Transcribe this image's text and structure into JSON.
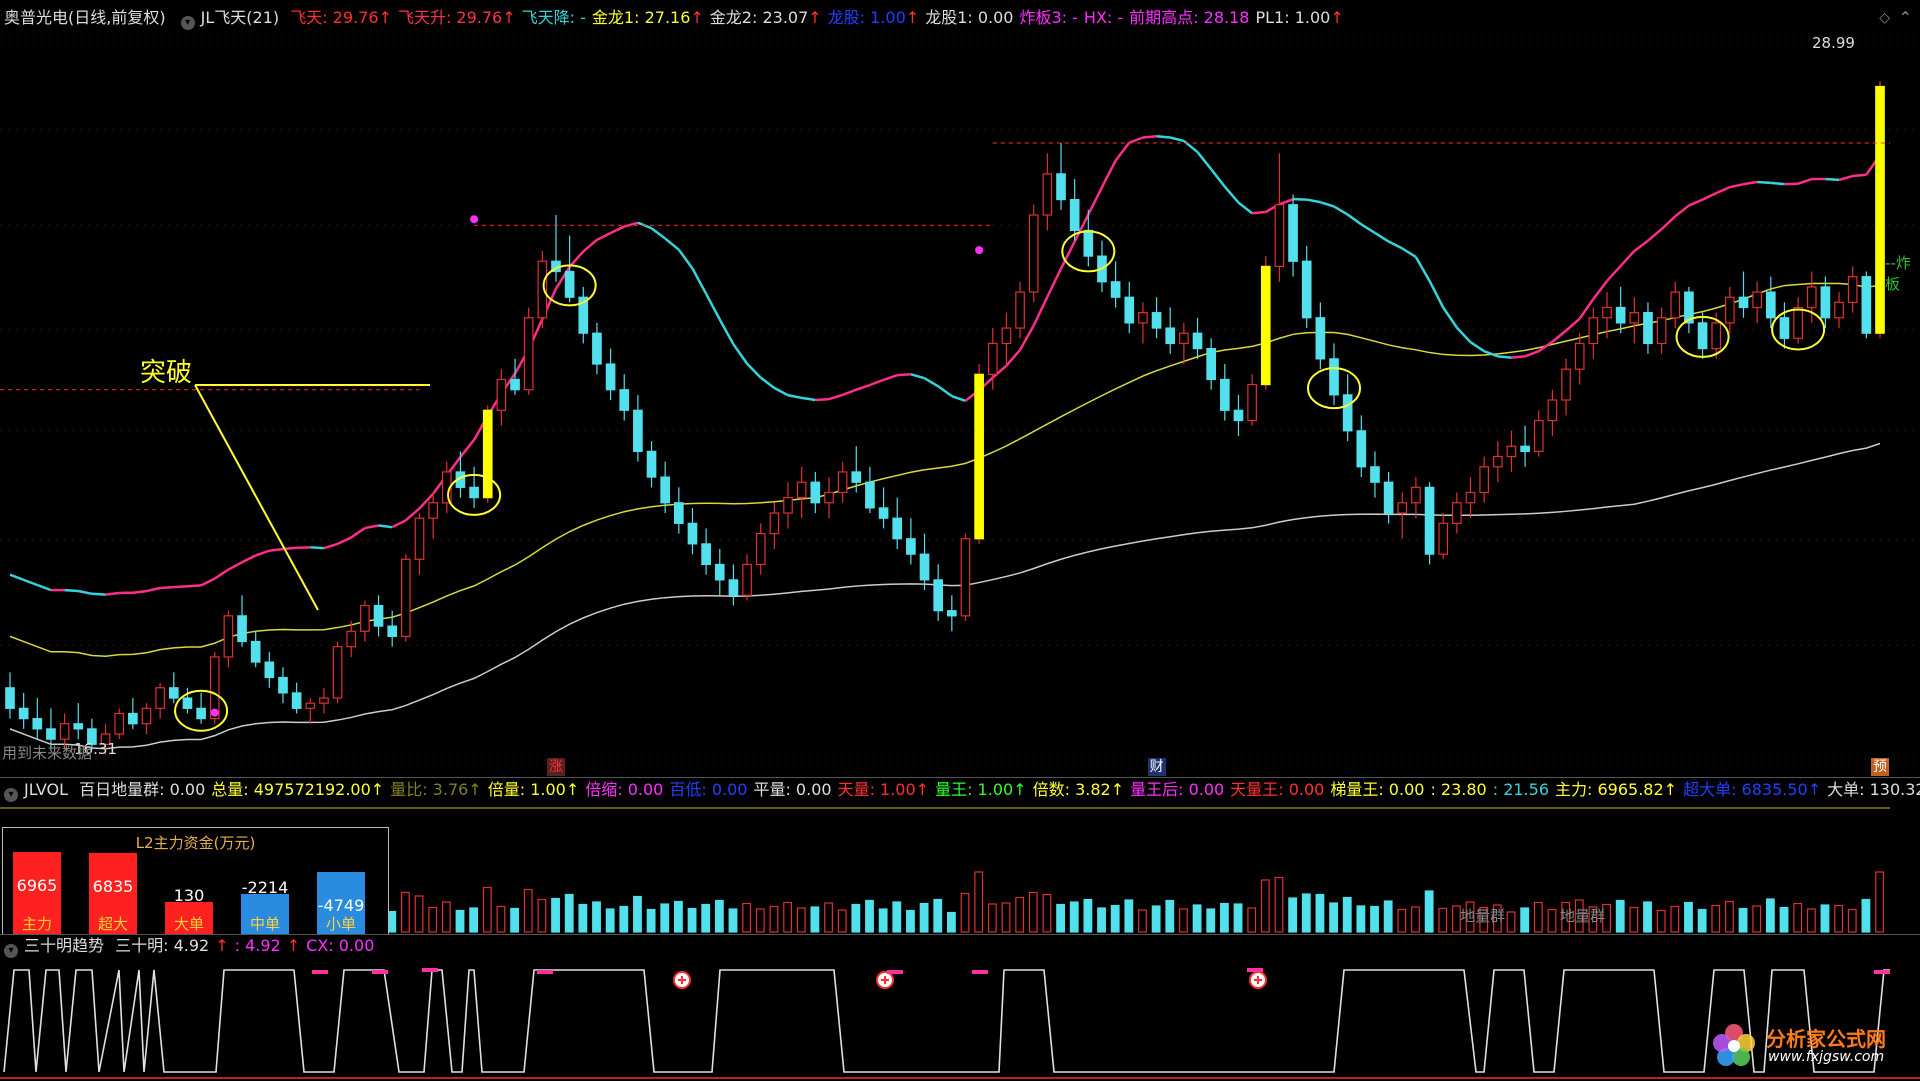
{
  "colors": {
    "up": "#e03030",
    "down": "#52e0ec",
    "yellow": "#ffff00",
    "pink": "#ff2e8a",
    "cyan": "#37d3db",
    "grey": "#bbbbbb"
  },
  "top_bar": {
    "stock": "奥普光电(日线,前复权)",
    "indicator": "JL飞天(21)",
    "items": [
      {
        "text": "飞天: 29.76",
        "color": "#ff3030",
        "arrow": "↑"
      },
      {
        "text": "飞天升: 29.76",
        "color": "#ff3050",
        "arrow": "↑"
      },
      {
        "text": "飞天降: -",
        "color": "#37d3db",
        "arrow": ""
      },
      {
        "text": "金龙1: 27.16",
        "color": "#ffff30",
        "arrow": "↑"
      },
      {
        "text": "金龙2: 23.07",
        "color": "#dddddd",
        "arrow": "↑"
      },
      {
        "text": "龙股: 1.00",
        "color": "#2040ff",
        "arrow": "↑"
      },
      {
        "text": "龙股1: 0.00",
        "color": "#dddddd",
        "arrow": ""
      },
      {
        "text": "炸板3: -",
        "color": "#ff30ff",
        "arrow": ""
      },
      {
        "text": "HX: -",
        "color": "#ff30ff",
        "arrow": ""
      },
      {
        "text": "前期高点: 28.18",
        "color": "#ff30ff",
        "arrow": ""
      },
      {
        "text": "PL1: 1.00",
        "color": "#dddddd",
        "arrow": "↑"
      }
    ]
  },
  "main_chart": {
    "price_label_right": "28.99",
    "low_label": "16.31",
    "bottom_left_text": "用到未来数据",
    "annotation": "突破",
    "markers": [
      {
        "text": "涨",
        "color": "#ff3030",
        "bg": "#552222"
      },
      {
        "text": "财",
        "color": "#ffffff",
        "bg": "#203070"
      },
      {
        "text": "预",
        "color": "#ffffff",
        "bg": "#c06020"
      }
    ],
    "right_edge_label": "--炸板"
  },
  "vol_bar": {
    "name": "JLVOL",
    "items": [
      {
        "text": "百日地量群: 0.00",
        "color": "#dddddd"
      },
      {
        "text": "总量: 497572192.00↑",
        "color": "#ffff30"
      },
      {
        "text": "量比: 3.76↑",
        "color": "#808020"
      },
      {
        "text": "倍量: 1.00↑",
        "color": "#ffff30"
      },
      {
        "text": "倍缩: 0.00",
        "color": "#ff30ff"
      },
      {
        "text": "百低: 0.00",
        "color": "#2040ff"
      },
      {
        "text": "平量: 0.00",
        "color": "#dddddd"
      },
      {
        "text": "天量: 1.00↑",
        "color": "#ff3030"
      },
      {
        "text": "量王: 1.00↑",
        "color": "#30ff30"
      },
      {
        "text": "倍数: 3.82↑",
        "color": "#ffff30"
      },
      {
        "text": "量王后: 0.00",
        "color": "#ff30ff"
      },
      {
        "text": "天量王: 0.00",
        "color": "#ff3030"
      },
      {
        "text": "梯量王: 0.00",
        "color": "#ffff30"
      },
      {
        "text": ": 23.80",
        "color": "#ffff30"
      },
      {
        "text": ": 21.56",
        "color": "#37d3db"
      },
      {
        "text": "主力: 6965.82↑",
        "color": "#ffff30"
      },
      {
        "text": "超大单: 6835.50↑",
        "color": "#2040ff"
      },
      {
        "text": "大单: 130.32↓",
        "color": "#dddddd"
      },
      {
        "text": "中单",
        "color": "#ffff30"
      }
    ],
    "l2_panel": {
      "title": "L2主力资金(万元)",
      "cols": [
        {
          "value": "6965",
          "label": "主力",
          "color": "#ff2020",
          "level": 1.0
        },
        {
          "value": "6835",
          "label": "超大",
          "color": "#ff2020",
          "level": 0.98
        },
        {
          "value": "130",
          "label": "大单",
          "color": "#ff2020",
          "level": 0.2
        },
        {
          "value": "-2214",
          "label": "中单",
          "color": "#2a8ce0",
          "level": 0.32
        },
        {
          "value": "-4749",
          "label": "小单",
          "color": "#2a8ce0",
          "level": 0.68
        }
      ]
    },
    "ground_labels": [
      "地量群",
      "地量群"
    ]
  },
  "trend_bar": {
    "name": "三十明趋势",
    "items": [
      {
        "text": "三十明: 4.92",
        "color": "#dddddd"
      },
      {
        "text": "↑",
        "color": "#ff3030"
      },
      {
        "text": ": 4.92",
        "color": "#ff30ff"
      },
      {
        "text": "↑",
        "color": "#ff3030"
      },
      {
        "text": "CX: 0.00",
        "color": "#ff30ff"
      }
    ]
  },
  "watermark": {
    "name": "分析家公式网",
    "url": "www.fxjgsw.com"
  },
  "chart_data": {
    "type": "candlestick",
    "title": "奥普光电(日线,前复权)",
    "price_label": 28.99,
    "low_label": 16.31,
    "ohlc": [
      [
        17.2,
        17.5,
        16.6,
        16.8
      ],
      [
        16.8,
        17.1,
        16.4,
        16.6
      ],
      [
        16.6,
        17.0,
        16.2,
        16.4
      ],
      [
        16.4,
        16.8,
        16.0,
        16.2
      ],
      [
        16.2,
        16.7,
        16.0,
        16.5
      ],
      [
        16.5,
        16.9,
        16.2,
        16.4
      ],
      [
        16.4,
        16.6,
        16.0,
        16.1
      ],
      [
        16.1,
        16.5,
        15.9,
        16.3
      ],
      [
        16.3,
        16.8,
        16.2,
        16.7
      ],
      [
        16.7,
        17.0,
        16.4,
        16.5
      ],
      [
        16.5,
        16.9,
        16.3,
        16.8
      ],
      [
        16.8,
        17.3,
        16.6,
        17.2
      ],
      [
        17.2,
        17.5,
        16.9,
        17.0
      ],
      [
        17.0,
        17.2,
        16.7,
        16.8
      ],
      [
        16.8,
        17.1,
        16.5,
        16.6
      ],
      [
        16.6,
        17.9,
        16.5,
        17.8
      ],
      [
        17.8,
        18.7,
        17.6,
        18.6
      ],
      [
        18.6,
        19.0,
        18.0,
        18.1
      ],
      [
        18.1,
        18.3,
        17.6,
        17.7
      ],
      [
        17.7,
        17.9,
        17.2,
        17.4
      ],
      [
        17.4,
        17.6,
        16.9,
        17.1
      ],
      [
        17.1,
        17.3,
        16.7,
        16.8
      ],
      [
        16.8,
        17.0,
        16.5,
        16.9
      ],
      [
        16.9,
        17.2,
        16.7,
        17.0
      ],
      [
        17.0,
        18.1,
        16.9,
        18.0
      ],
      [
        18.0,
        18.5,
        17.8,
        18.3
      ],
      [
        18.3,
        18.9,
        18.1,
        18.8
      ],
      [
        18.8,
        19.0,
        18.2,
        18.4
      ],
      [
        18.4,
        18.7,
        18.0,
        18.2
      ],
      [
        18.2,
        19.8,
        18.1,
        19.7
      ],
      [
        19.7,
        20.6,
        19.4,
        20.5
      ],
      [
        20.5,
        21.0,
        20.1,
        20.8
      ],
      [
        20.8,
        21.6,
        20.6,
        21.4
      ],
      [
        21.4,
        21.8,
        20.9,
        21.1
      ],
      [
        21.1,
        21.5,
        20.7,
        20.9
      ],
      [
        20.9,
        22.7,
        20.8,
        22.6
      ],
      [
        22.6,
        23.4,
        22.3,
        23.2
      ],
      [
        23.2,
        23.6,
        22.9,
        23.0
      ],
      [
        23.0,
        24.6,
        22.9,
        24.4
      ],
      [
        24.4,
        25.7,
        24.2,
        25.5
      ],
      [
        25.5,
        26.4,
        25.1,
        25.3
      ],
      [
        25.3,
        26.0,
        24.7,
        24.8
      ],
      [
        24.8,
        25.0,
        23.9,
        24.1
      ],
      [
        24.1,
        24.3,
        23.3,
        23.5
      ],
      [
        23.5,
        23.8,
        22.8,
        23.0
      ],
      [
        23.0,
        23.3,
        22.4,
        22.6
      ],
      [
        22.6,
        22.9,
        21.6,
        21.8
      ],
      [
        21.8,
        22.0,
        21.1,
        21.3
      ],
      [
        21.3,
        21.6,
        20.6,
        20.8
      ],
      [
        20.8,
        21.1,
        20.2,
        20.4
      ],
      [
        20.4,
        20.7,
        19.8,
        20.0
      ],
      [
        20.0,
        20.3,
        19.4,
        19.6
      ],
      [
        19.6,
        19.9,
        19.0,
        19.3
      ],
      [
        19.3,
        19.6,
        18.8,
        19.0
      ],
      [
        19.0,
        19.8,
        18.9,
        19.6
      ],
      [
        19.6,
        20.4,
        19.4,
        20.2
      ],
      [
        20.2,
        20.8,
        19.9,
        20.6
      ],
      [
        20.6,
        21.2,
        20.3,
        20.9
      ],
      [
        20.9,
        21.5,
        20.5,
        21.2
      ],
      [
        21.2,
        21.4,
        20.6,
        20.8
      ],
      [
        20.8,
        21.3,
        20.5,
        21.0
      ],
      [
        21.0,
        21.6,
        20.8,
        21.4
      ],
      [
        21.4,
        21.9,
        21.0,
        21.2
      ],
      [
        21.2,
        21.5,
        20.6,
        20.7
      ],
      [
        20.7,
        21.1,
        20.3,
        20.5
      ],
      [
        20.5,
        20.9,
        19.9,
        20.1
      ],
      [
        20.1,
        20.5,
        19.6,
        19.8
      ],
      [
        19.8,
        20.2,
        19.1,
        19.3
      ],
      [
        19.3,
        19.6,
        18.5,
        18.7
      ],
      [
        18.7,
        19.0,
        18.3,
        18.6
      ],
      [
        18.6,
        20.2,
        18.5,
        20.1
      ],
      [
        20.1,
        23.5,
        20.0,
        23.3
      ],
      [
        23.3,
        24.2,
        23.0,
        23.9
      ],
      [
        23.9,
        24.5,
        23.5,
        24.2
      ],
      [
        24.2,
        25.1,
        24.0,
        24.9
      ],
      [
        24.9,
        26.6,
        24.7,
        26.4
      ],
      [
        26.4,
        27.6,
        26.1,
        27.2
      ],
      [
        27.2,
        27.8,
        26.5,
        26.7
      ],
      [
        26.7,
        27.1,
        25.9,
        26.1
      ],
      [
        26.1,
        26.5,
        25.4,
        25.6
      ],
      [
        25.6,
        25.9,
        24.9,
        25.1
      ],
      [
        25.1,
        25.5,
        24.6,
        24.8
      ],
      [
        24.8,
        25.1,
        24.1,
        24.3
      ],
      [
        24.3,
        24.7,
        23.9,
        24.5
      ],
      [
        24.5,
        24.8,
        24.0,
        24.2
      ],
      [
        24.2,
        24.6,
        23.7,
        23.9
      ],
      [
        23.9,
        24.3,
        23.5,
        24.1
      ],
      [
        24.1,
        24.4,
        23.6,
        23.8
      ],
      [
        23.8,
        24.0,
        23.0,
        23.2
      ],
      [
        23.2,
        23.5,
        22.4,
        22.6
      ],
      [
        22.6,
        22.9,
        22.1,
        22.4
      ],
      [
        22.4,
        23.3,
        22.3,
        23.1
      ],
      [
        23.1,
        25.6,
        23.0,
        25.4
      ],
      [
        25.4,
        27.6,
        25.1,
        26.6
      ],
      [
        26.6,
        26.8,
        25.2,
        25.5
      ],
      [
        25.5,
        25.8,
        24.2,
        24.4
      ],
      [
        24.4,
        24.7,
        23.4,
        23.6
      ],
      [
        23.6,
        23.9,
        22.7,
        22.9
      ],
      [
        22.9,
        23.3,
        22.0,
        22.2
      ],
      [
        22.2,
        22.5,
        21.3,
        21.5
      ],
      [
        21.5,
        21.8,
        20.9,
        21.2
      ],
      [
        21.2,
        21.4,
        20.4,
        20.6
      ],
      [
        20.6,
        21.0,
        20.1,
        20.8
      ],
      [
        20.8,
        21.3,
        20.5,
        21.1
      ],
      [
        21.1,
        21.2,
        19.6,
        19.8
      ],
      [
        19.8,
        20.6,
        19.7,
        20.4
      ],
      [
        20.4,
        21.0,
        20.2,
        20.8
      ],
      [
        20.8,
        21.3,
        20.5,
        21.0
      ],
      [
        21.0,
        21.7,
        20.8,
        21.5
      ],
      [
        21.5,
        22.0,
        21.2,
        21.7
      ],
      [
        21.7,
        22.2,
        21.4,
        21.9
      ],
      [
        21.9,
        22.3,
        21.5,
        21.8
      ],
      [
        21.8,
        22.6,
        21.7,
        22.4
      ],
      [
        22.4,
        23.0,
        22.1,
        22.8
      ],
      [
        22.8,
        23.6,
        22.5,
        23.4
      ],
      [
        23.4,
        24.1,
        23.1,
        23.9
      ],
      [
        23.9,
        24.6,
        23.6,
        24.4
      ],
      [
        24.4,
        24.9,
        24.0,
        24.6
      ],
      [
        24.6,
        25.0,
        24.1,
        24.3
      ],
      [
        24.3,
        24.8,
        23.9,
        24.5
      ],
      [
        24.5,
        24.7,
        23.7,
        23.9
      ],
      [
        23.9,
        24.6,
        23.7,
        24.4
      ],
      [
        24.4,
        25.1,
        24.2,
        24.9
      ],
      [
        24.9,
        25.0,
        24.1,
        24.3
      ],
      [
        24.3,
        24.5,
        23.6,
        23.8
      ],
      [
        23.8,
        24.5,
        23.6,
        24.3
      ],
      [
        24.3,
        25.0,
        24.1,
        24.8
      ],
      [
        24.8,
        25.3,
        24.4,
        24.6
      ],
      [
        24.6,
        25.1,
        24.3,
        24.9
      ],
      [
        24.9,
        25.2,
        24.2,
        24.4
      ],
      [
        24.4,
        24.7,
        23.8,
        24.0
      ],
      [
        24.0,
        24.8,
        23.9,
        24.6
      ],
      [
        24.6,
        25.3,
        24.3,
        25.0
      ],
      [
        25.0,
        25.2,
        24.2,
        24.4
      ],
      [
        24.4,
        24.9,
        24.2,
        24.7
      ],
      [
        24.7,
        25.4,
        24.5,
        25.2
      ],
      [
        25.2,
        25.3,
        24.0,
        24.1
      ],
      [
        24.1,
        29.0,
        24.0,
        28.9
      ]
    ],
    "ma_yellow_ends": [
      21.2,
      24.9
    ],
    "ma_white_ends": [
      17.8,
      22.6
    ]
  }
}
